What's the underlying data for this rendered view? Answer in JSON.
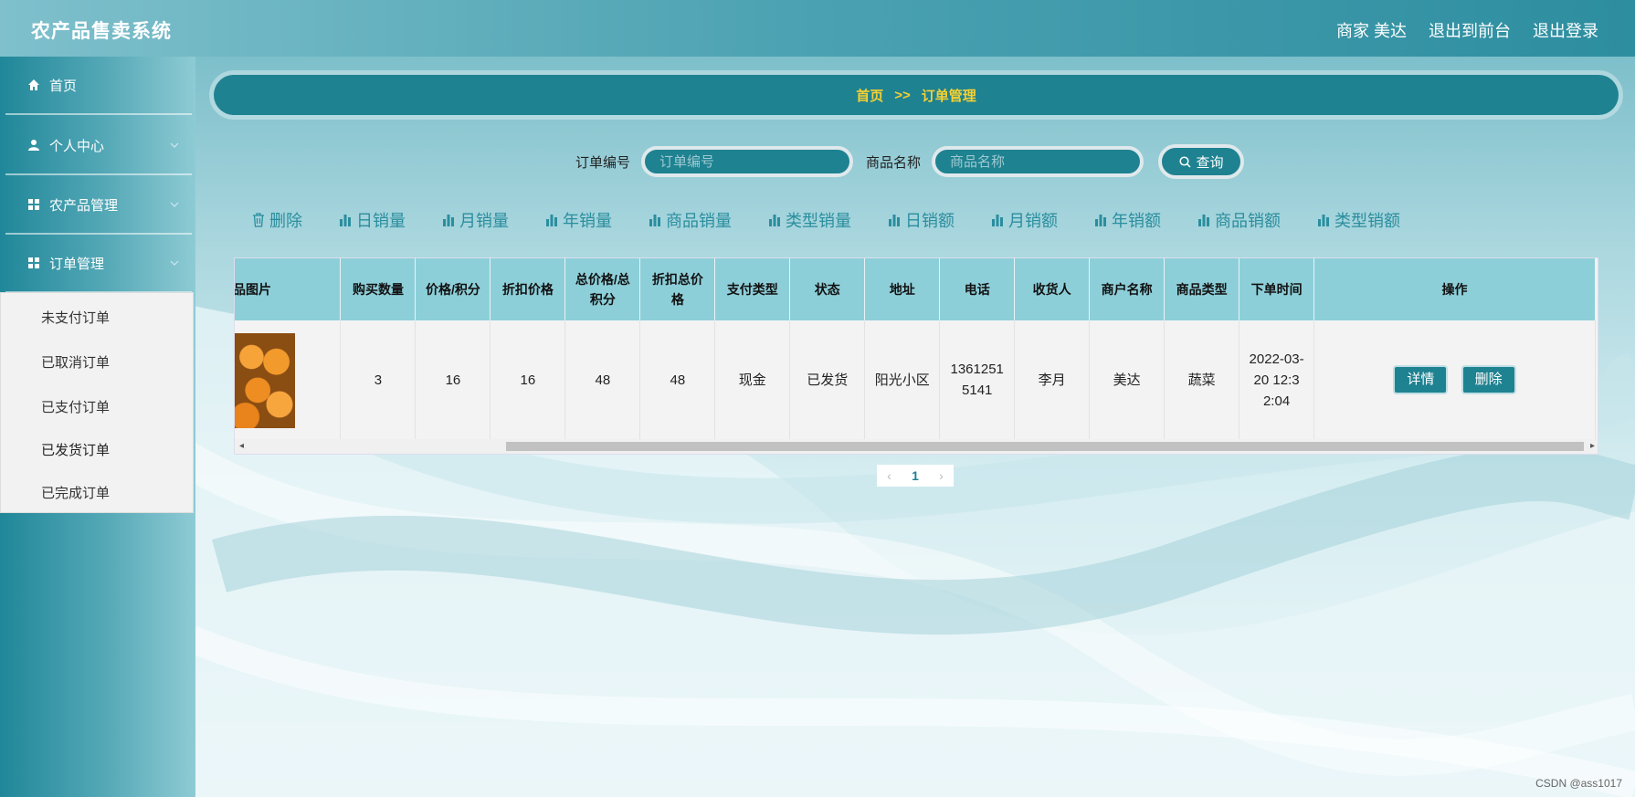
{
  "app": {
    "title": "农产品售卖系统"
  },
  "top_links": {
    "user": "商家 美达",
    "frontend": "退出到前台",
    "logout": "退出登录"
  },
  "sidebar": {
    "items": [
      {
        "label": "首页",
        "icon": "home-icon"
      },
      {
        "label": "个人中心",
        "icon": "user-icon"
      },
      {
        "label": "农产品管理",
        "icon": "grid-icon"
      },
      {
        "label": "订单管理",
        "icon": "grid-icon"
      }
    ],
    "submenu": [
      "未支付订单",
      "已取消订单",
      "已支付订单",
      "已发货订单",
      "已完成订单"
    ]
  },
  "breadcrumb": {
    "home": "首页",
    "sep": ">>",
    "current": "订单管理"
  },
  "search": {
    "order_label": "订单编号",
    "order_placeholder": "订单编号",
    "product_label": "商品名称",
    "product_placeholder": "商品名称",
    "query_label": "查询"
  },
  "toolbar": {
    "delete": "删除",
    "daily_sales": "日销量",
    "monthly_sales": "月销量",
    "yearly_sales": "年销量",
    "product_sales": "商品销量",
    "type_sales": "类型销量",
    "daily_amount": "日销额",
    "monthly_amount": "月销额",
    "yearly_amount": "年销额",
    "product_amount": "商品销额",
    "type_amount": "类型销额"
  },
  "table": {
    "headers": {
      "image": "品图片",
      "qty": "购买数量",
      "price": "价格/积分",
      "discount": "折扣价格",
      "total": "总价格/总积分",
      "discount_total": "折扣总价格",
      "pay_type": "支付类型",
      "status": "状态",
      "address": "地址",
      "phone": "电话",
      "receiver": "收货人",
      "merchant": "商户名称",
      "category": "商品类型",
      "time": "下单时间",
      "ops": "操作"
    },
    "row": {
      "qty": "3",
      "price": "16",
      "discount": "16",
      "total": "48",
      "discount_total": "48",
      "pay_type": "现金",
      "status": "已发货",
      "address": "阳光小区",
      "phone": "13612515141",
      "receiver": "李月",
      "merchant": "美达",
      "category": "蔬菜",
      "time": "2022-03-20 12:32:04",
      "detail_btn": "详情",
      "delete_btn": "删除"
    }
  },
  "pagination": {
    "current": "1"
  },
  "watermark": "CSDN @ass1017"
}
